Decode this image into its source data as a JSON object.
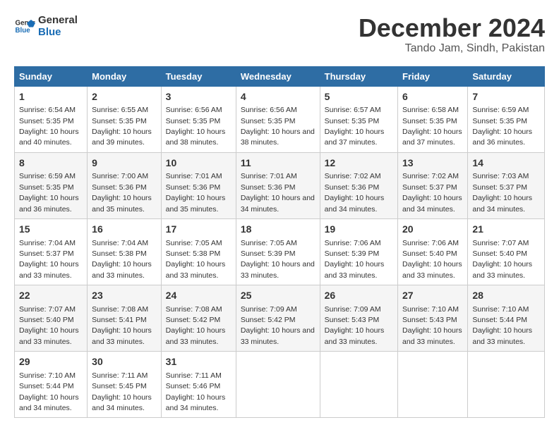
{
  "logo": {
    "line1": "General",
    "line2": "Blue"
  },
  "title": "December 2024",
  "subtitle": "Tando Jam, Sindh, Pakistan",
  "headers": [
    "Sunday",
    "Monday",
    "Tuesday",
    "Wednesday",
    "Thursday",
    "Friday",
    "Saturday"
  ],
  "weeks": [
    [
      {
        "day": "1",
        "sunrise": "Sunrise: 6:54 AM",
        "sunset": "Sunset: 5:35 PM",
        "daylight": "Daylight: 10 hours and 40 minutes."
      },
      {
        "day": "2",
        "sunrise": "Sunrise: 6:55 AM",
        "sunset": "Sunset: 5:35 PM",
        "daylight": "Daylight: 10 hours and 39 minutes."
      },
      {
        "day": "3",
        "sunrise": "Sunrise: 6:56 AM",
        "sunset": "Sunset: 5:35 PM",
        "daylight": "Daylight: 10 hours and 38 minutes."
      },
      {
        "day": "4",
        "sunrise": "Sunrise: 6:56 AM",
        "sunset": "Sunset: 5:35 PM",
        "daylight": "Daylight: 10 hours and 38 minutes."
      },
      {
        "day": "5",
        "sunrise": "Sunrise: 6:57 AM",
        "sunset": "Sunset: 5:35 PM",
        "daylight": "Daylight: 10 hours and 37 minutes."
      },
      {
        "day": "6",
        "sunrise": "Sunrise: 6:58 AM",
        "sunset": "Sunset: 5:35 PM",
        "daylight": "Daylight: 10 hours and 37 minutes."
      },
      {
        "day": "7",
        "sunrise": "Sunrise: 6:59 AM",
        "sunset": "Sunset: 5:35 PM",
        "daylight": "Daylight: 10 hours and 36 minutes."
      }
    ],
    [
      {
        "day": "8",
        "sunrise": "Sunrise: 6:59 AM",
        "sunset": "Sunset: 5:35 PM",
        "daylight": "Daylight: 10 hours and 36 minutes."
      },
      {
        "day": "9",
        "sunrise": "Sunrise: 7:00 AM",
        "sunset": "Sunset: 5:36 PM",
        "daylight": "Daylight: 10 hours and 35 minutes."
      },
      {
        "day": "10",
        "sunrise": "Sunrise: 7:01 AM",
        "sunset": "Sunset: 5:36 PM",
        "daylight": "Daylight: 10 hours and 35 minutes."
      },
      {
        "day": "11",
        "sunrise": "Sunrise: 7:01 AM",
        "sunset": "Sunset: 5:36 PM",
        "daylight": "Daylight: 10 hours and 34 minutes."
      },
      {
        "day": "12",
        "sunrise": "Sunrise: 7:02 AM",
        "sunset": "Sunset: 5:36 PM",
        "daylight": "Daylight: 10 hours and 34 minutes."
      },
      {
        "day": "13",
        "sunrise": "Sunrise: 7:02 AM",
        "sunset": "Sunset: 5:37 PM",
        "daylight": "Daylight: 10 hours and 34 minutes."
      },
      {
        "day": "14",
        "sunrise": "Sunrise: 7:03 AM",
        "sunset": "Sunset: 5:37 PM",
        "daylight": "Daylight: 10 hours and 34 minutes."
      }
    ],
    [
      {
        "day": "15",
        "sunrise": "Sunrise: 7:04 AM",
        "sunset": "Sunset: 5:37 PM",
        "daylight": "Daylight: 10 hours and 33 minutes."
      },
      {
        "day": "16",
        "sunrise": "Sunrise: 7:04 AM",
        "sunset": "Sunset: 5:38 PM",
        "daylight": "Daylight: 10 hours and 33 minutes."
      },
      {
        "day": "17",
        "sunrise": "Sunrise: 7:05 AM",
        "sunset": "Sunset: 5:38 PM",
        "daylight": "Daylight: 10 hours and 33 minutes."
      },
      {
        "day": "18",
        "sunrise": "Sunrise: 7:05 AM",
        "sunset": "Sunset: 5:39 PM",
        "daylight": "Daylight: 10 hours and 33 minutes."
      },
      {
        "day": "19",
        "sunrise": "Sunrise: 7:06 AM",
        "sunset": "Sunset: 5:39 PM",
        "daylight": "Daylight: 10 hours and 33 minutes."
      },
      {
        "day": "20",
        "sunrise": "Sunrise: 7:06 AM",
        "sunset": "Sunset: 5:40 PM",
        "daylight": "Daylight: 10 hours and 33 minutes."
      },
      {
        "day": "21",
        "sunrise": "Sunrise: 7:07 AM",
        "sunset": "Sunset: 5:40 PM",
        "daylight": "Daylight: 10 hours and 33 minutes."
      }
    ],
    [
      {
        "day": "22",
        "sunrise": "Sunrise: 7:07 AM",
        "sunset": "Sunset: 5:40 PM",
        "daylight": "Daylight: 10 hours and 33 minutes."
      },
      {
        "day": "23",
        "sunrise": "Sunrise: 7:08 AM",
        "sunset": "Sunset: 5:41 PM",
        "daylight": "Daylight: 10 hours and 33 minutes."
      },
      {
        "day": "24",
        "sunrise": "Sunrise: 7:08 AM",
        "sunset": "Sunset: 5:42 PM",
        "daylight": "Daylight: 10 hours and 33 minutes."
      },
      {
        "day": "25",
        "sunrise": "Sunrise: 7:09 AM",
        "sunset": "Sunset: 5:42 PM",
        "daylight": "Daylight: 10 hours and 33 minutes."
      },
      {
        "day": "26",
        "sunrise": "Sunrise: 7:09 AM",
        "sunset": "Sunset: 5:43 PM",
        "daylight": "Daylight: 10 hours and 33 minutes."
      },
      {
        "day": "27",
        "sunrise": "Sunrise: 7:10 AM",
        "sunset": "Sunset: 5:43 PM",
        "daylight": "Daylight: 10 hours and 33 minutes."
      },
      {
        "day": "28",
        "sunrise": "Sunrise: 7:10 AM",
        "sunset": "Sunset: 5:44 PM",
        "daylight": "Daylight: 10 hours and 33 minutes."
      }
    ],
    [
      {
        "day": "29",
        "sunrise": "Sunrise: 7:10 AM",
        "sunset": "Sunset: 5:44 PM",
        "daylight": "Daylight: 10 hours and 34 minutes."
      },
      {
        "day": "30",
        "sunrise": "Sunrise: 7:11 AM",
        "sunset": "Sunset: 5:45 PM",
        "daylight": "Daylight: 10 hours and 34 minutes."
      },
      {
        "day": "31",
        "sunrise": "Sunrise: 7:11 AM",
        "sunset": "Sunset: 5:46 PM",
        "daylight": "Daylight: 10 hours and 34 minutes."
      },
      null,
      null,
      null,
      null
    ]
  ]
}
